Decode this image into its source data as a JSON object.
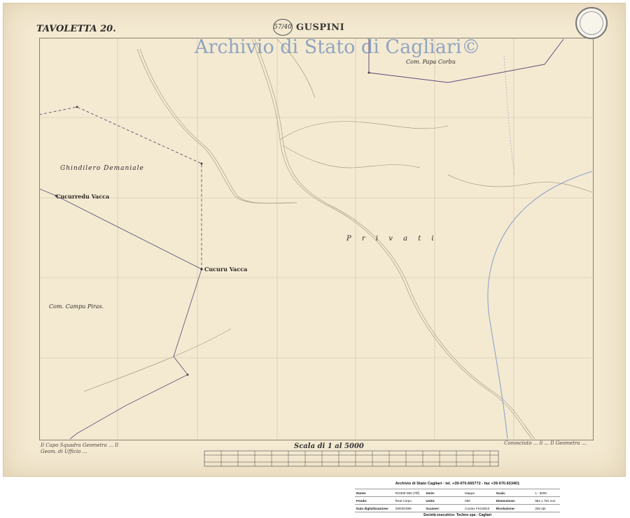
{
  "sheet": {
    "tavoletta": "TAVOLETTA 20.",
    "place_name": "GUSPINI",
    "folio": "57/40",
    "watermark": "Archivio di Stato di Cagliari©"
  },
  "map_labels": {
    "com_papa_corbu": "Com.   Papa Corbu",
    "ghindilero": "Ghindilero    Demaniale",
    "cucurredu_vacca": "Cucurredu Vacca",
    "cucuru_vacca": "Cucuru Vacca",
    "com_campu_piras": "Com.   Campu   Piras.",
    "privati": "P  r  i  v  a  t  i"
  },
  "scale": {
    "title": "Scala di 1 al 5000"
  },
  "signatures": {
    "left": "Il Capo Squadra Geometra ... Il Geom. di Ufficio ...",
    "right": "Conosciuto ... li ... Il Geometra ..."
  },
  "archive_info": {
    "header": "Archivio di Stato Cagliari - tel. +39-070.665772 - fax +39-070.653401",
    "rows": [
      {
        "k1": "Nome:",
        "v1": "R/2300-050  (Tiff)",
        "k2": "Serie:",
        "v2": "Mappe",
        "k3": "Scala:",
        "v3": "1 : 5000"
      },
      {
        "k1": "Fondo:",
        "v1": "Real Corpo",
        "k2": "Unità:",
        "v2": "050",
        "k3": "Dimensione:",
        "v3": "981 x 781 mm"
      },
      {
        "k1": "Data digitalizzazione:",
        "v1": "29/03/1999",
        "k2": "Scanner:",
        "v2": "Contex FSC8010",
        "k3": "Risoluzione:",
        "v3": "200 dpi"
      }
    ],
    "footer": "Società esecutrice: Techno spa - Cagliari"
  },
  "colors": {
    "paper": "#f4ead2",
    "grid": "#c9bfae",
    "watermark": "#6e8cb9",
    "boundary_purple": "#6a4a7a"
  }
}
